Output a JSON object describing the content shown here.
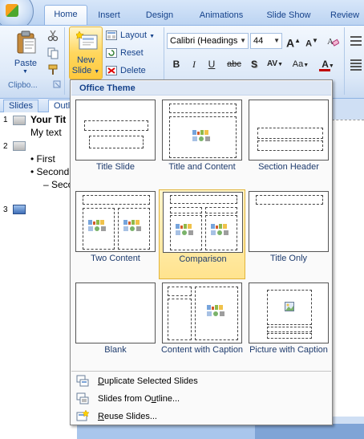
{
  "tabs": [
    "Home",
    "Insert",
    "Design",
    "Animations",
    "Slide Show",
    "Review"
  ],
  "clipboard": {
    "paste_label": "Paste",
    "group_label": "Clipbo..."
  },
  "slides_group": {
    "new_slide_label_1": "New",
    "new_slide_label_2": "Slide",
    "layout_label": "Layout",
    "reset_label": "Reset",
    "delete_label": "Delete"
  },
  "font_group": {
    "font_name": "Calibri (Headings",
    "font_size": "44",
    "bold": "B",
    "italic": "I",
    "underline": "U",
    "strike": "abc",
    "shadow": "S",
    "spacing": "AV",
    "change_case": "Aa",
    "font_color": "A",
    "grow": "A",
    "shrink": "A"
  },
  "pane_tabs": [
    "Slides",
    "Outl"
  ],
  "outline": {
    "slide1_num": "1",
    "slide1_title": "Your Tit",
    "slide1_text": "My text",
    "slide2_num": "2",
    "slide2_bullet1": "First",
    "slide2_bullet2": "Second",
    "slide2_sub": "– Seco",
    "slide3_num": "3"
  },
  "gallery": {
    "header": "Office Theme",
    "layouts": [
      {
        "label": "Title Slide"
      },
      {
        "label": "Title and Content"
      },
      {
        "label": "Section Header"
      },
      {
        "label": "Two Content"
      },
      {
        "label": "Comparison"
      },
      {
        "label": "Title Only"
      },
      {
        "label": "Blank"
      },
      {
        "label": "Content with Caption"
      },
      {
        "label": "Picture with Caption"
      }
    ],
    "selected_layout": "Comparison",
    "menu": [
      {
        "underline": "D",
        "rest": "uplicate Selected Slides"
      },
      {
        "prefix": "Slides from O",
        "underline": "u",
        "rest": "tline..."
      },
      {
        "underline": "R",
        "rest": "euse Slides..."
      }
    ]
  },
  "colors": {
    "ribbon_text": "#15428b",
    "selection_fill": "#ffe38e",
    "selection_border": "#e2b43a",
    "font_color_bar": "#c00000"
  }
}
